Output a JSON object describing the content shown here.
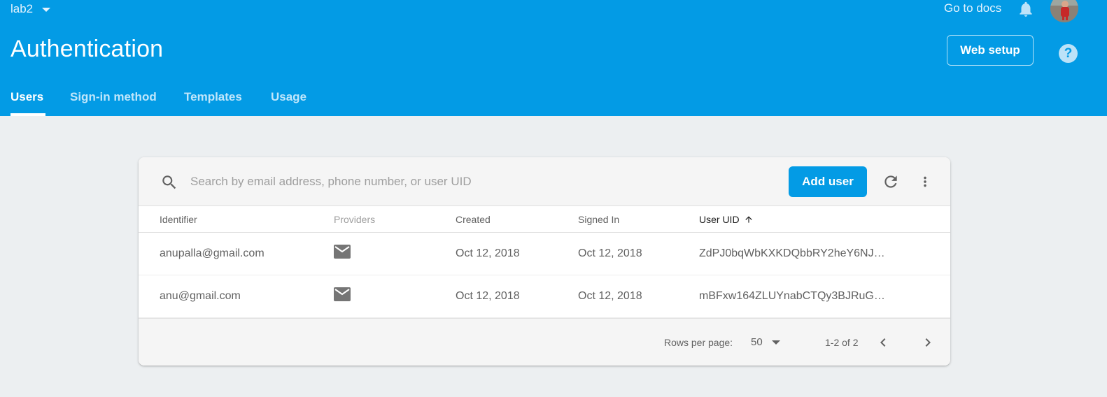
{
  "header": {
    "project_name": "lab2",
    "go_to_docs": "Go to docs",
    "page_title": "Authentication",
    "web_setup_label": "Web setup",
    "help_glyph": "?",
    "icons": [
      "chevron-down-icon",
      "bell-icon",
      "avatar",
      "help-icon"
    ],
    "background_color": "#039be5"
  },
  "tabs": [
    {
      "label": "Users",
      "active": true
    },
    {
      "label": "Sign-in method",
      "active": false
    },
    {
      "label": "Templates",
      "active": false
    },
    {
      "label": "Usage",
      "active": false
    }
  ],
  "users_table": {
    "search": {
      "placeholder": "Search by email address, phone number, or user UID",
      "value": ""
    },
    "add_user_label": "Add user",
    "toolbar_icons": [
      "search-icon",
      "refresh-icon",
      "more-vert-icon"
    ],
    "columns": [
      "Identifier",
      "Providers",
      "Created",
      "Signed In",
      "User UID"
    ],
    "sorted_column": "User UID",
    "sort_direction": "ascending",
    "rows": [
      {
        "identifier": "anupalla@gmail.com",
        "provider": "email-icon",
        "created": "Oct 12, 2018",
        "signed_in": "Oct 12, 2018",
        "uid": "ZdPJ0bqWbKXKDQbbRY2heY6NJ…"
      },
      {
        "identifier": "anu@gmail.com",
        "provider": "email-icon",
        "created": "Oct 12, 2018",
        "signed_in": "Oct 12, 2018",
        "uid": "mBFxw164ZLUYnabCTQy3BJRuG…"
      }
    ],
    "pagination": {
      "rows_per_page_label": "Rows per page:",
      "rows_per_page": "50",
      "range": "1-2 of 2"
    },
    "accent_color": "#039be5"
  }
}
